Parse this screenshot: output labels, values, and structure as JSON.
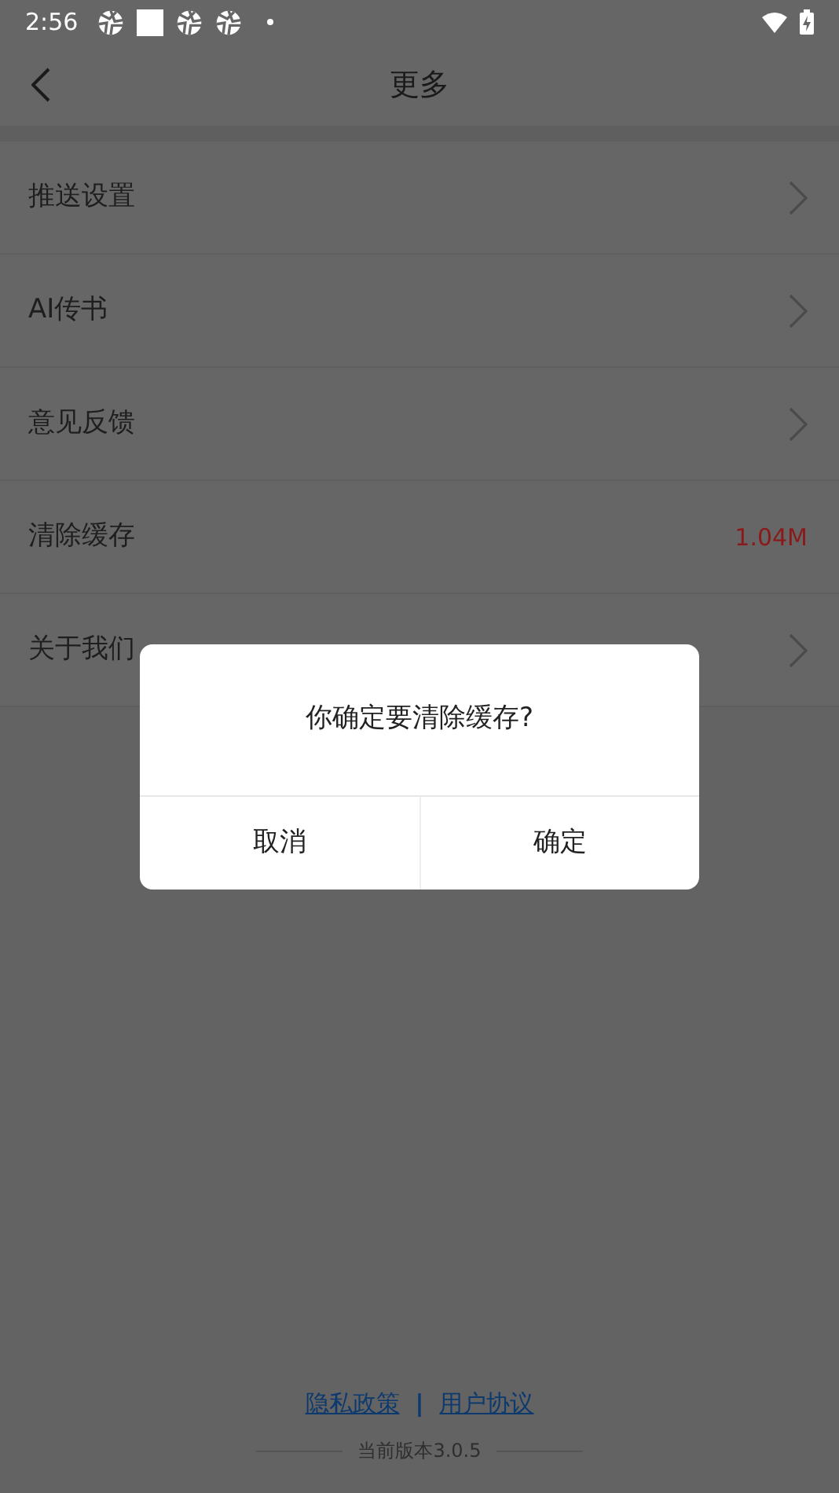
{
  "status_bar": {
    "time": "2:56"
  },
  "header": {
    "title": "更多"
  },
  "menu": [
    {
      "label": "推送设置",
      "kind": "arrow"
    },
    {
      "label": "AI传书",
      "kind": "arrow"
    },
    {
      "label": "意见反馈",
      "kind": "arrow"
    },
    {
      "label": "清除缓存",
      "kind": "value",
      "value": "1.04M"
    },
    {
      "label": "关于我们",
      "kind": "arrow"
    }
  ],
  "footer": {
    "links": [
      "隐私政策",
      "用户协议"
    ],
    "separator": "|",
    "version": "当前版本3.0.5"
  },
  "dialog": {
    "message": "你确定要清除缓存?",
    "buttons": [
      "取消",
      "确定"
    ]
  }
}
